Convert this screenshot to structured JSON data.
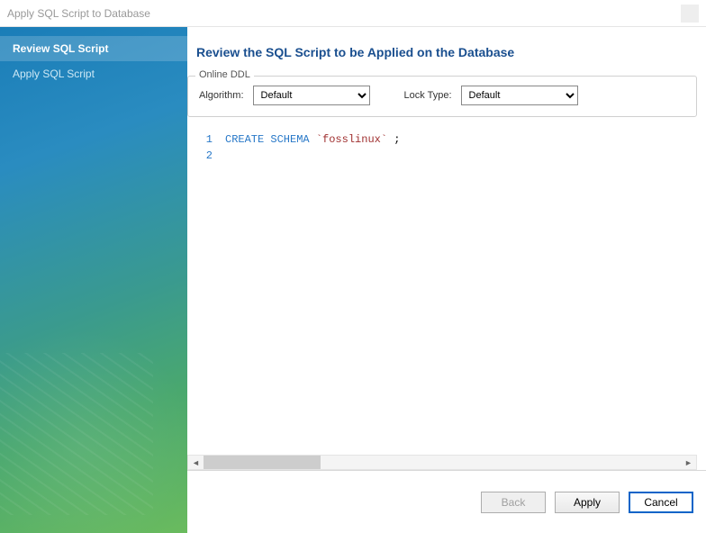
{
  "titlebar": {
    "text": "Apply SQL Script to Database"
  },
  "sidebar": {
    "items": [
      {
        "label": "Review SQL Script",
        "active": true
      },
      {
        "label": "Apply SQL Script",
        "active": false
      }
    ]
  },
  "header": {
    "title": "Review the SQL Script to be Applied on the Database"
  },
  "ddl": {
    "legend": "Online DDL",
    "algorithm_label": "Algorithm:",
    "algorithm_value": "Default",
    "locktype_label": "Lock Type:",
    "locktype_value": "Default"
  },
  "editor": {
    "lines": [
      {
        "num": "1",
        "kw": "CREATE SCHEMA",
        "ident": "`fosslinux`",
        "tail": " ;"
      },
      {
        "num": "2",
        "kw": "",
        "ident": "",
        "tail": ""
      }
    ]
  },
  "footer": {
    "back": "Back",
    "apply": "Apply",
    "cancel": "Cancel"
  }
}
